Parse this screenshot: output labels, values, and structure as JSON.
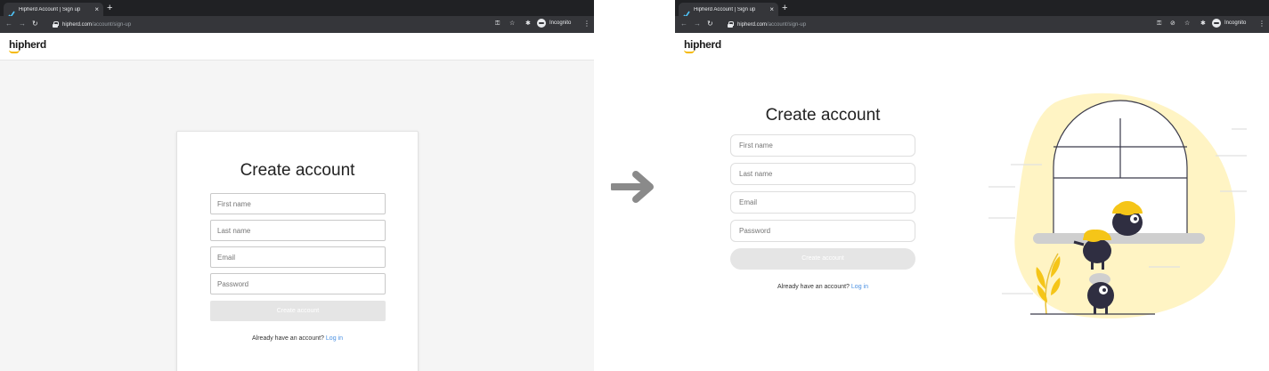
{
  "browser": {
    "tab_title": "Hipherd Account | Sign up",
    "tab_close": "×",
    "new_tab": "+",
    "url_host": "hipherd.com",
    "url_path": "/account/sign-up",
    "incognito_label": "Incognito"
  },
  "site": {
    "logo": "hipherd"
  },
  "form": {
    "title": "Create account",
    "first_name_placeholder": "First name",
    "last_name_placeholder": "Last name",
    "email_placeholder": "Email",
    "password_placeholder": "Password",
    "submit_label": "Create account",
    "login_prompt": "Already have an account?",
    "login_link": "Log in"
  },
  "colors": {
    "accent_yellow": "#f5b800",
    "link_blue": "#4a90e2",
    "chrome_dark": "#202124",
    "toolbar": "#35363a"
  },
  "icons": [
    "back-arrow-icon",
    "forward-arrow-icon",
    "reload-icon",
    "lock-icon",
    "key-icon",
    "eye-off-icon",
    "star-icon",
    "extensions-icon",
    "incognito-icon",
    "menu-kebab-icon",
    "right-arrow-icon"
  ]
}
